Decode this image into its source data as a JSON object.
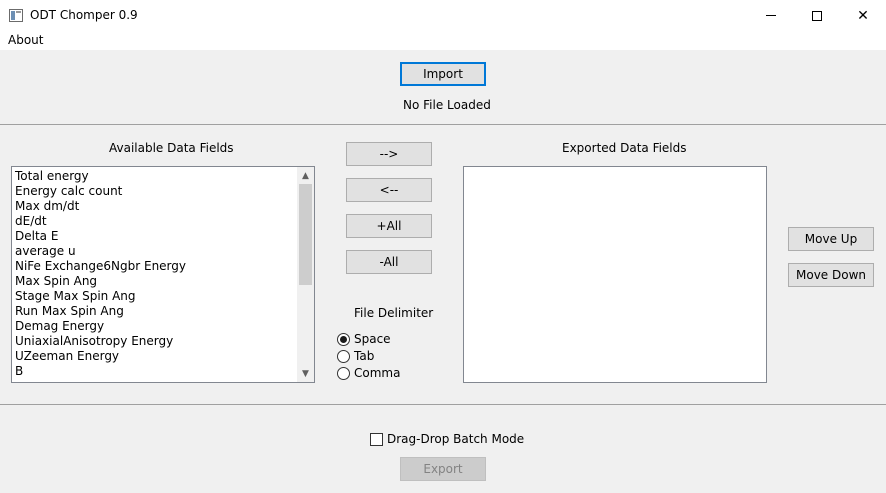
{
  "window": {
    "title": "ODT Chomper 0.9",
    "controls": {
      "minimize": "minimize",
      "maximize": "maximize",
      "close": "✕"
    }
  },
  "menubar": {
    "about": "About"
  },
  "import": {
    "button_label": "Import",
    "status": "No File Loaded"
  },
  "available": {
    "heading": "Available Data Fields",
    "items": [
      "Total energy",
      "Energy calc count",
      "Max dm/dt",
      "dE/dt",
      "Delta E",
      "average u",
      "NiFe Exchange6Ngbr Energy",
      "Max Spin Ang",
      "Stage Max Spin Ang",
      "Run Max Spin Ang",
      "Demag Energy",
      "UniaxialAnisotropy Energy",
      "UZeeman Energy",
      "B"
    ]
  },
  "transfer": {
    "add": "-->",
    "remove": "<--",
    "add_all": "+All",
    "remove_all": "-All"
  },
  "delimiter": {
    "heading": "File Delimiter",
    "options": [
      "Space",
      "Tab",
      "Comma"
    ],
    "selected": "Space"
  },
  "exported": {
    "heading": "Exported Data Fields",
    "items": []
  },
  "order": {
    "move_up": "Move Up",
    "move_down": "Move Down"
  },
  "batch": {
    "label": "Drag-Drop Batch Mode",
    "checked": false
  },
  "export": {
    "button_label": "Export",
    "enabled": false
  },
  "icons": {
    "scroll_up": "▲",
    "scroll_down": "▼"
  }
}
